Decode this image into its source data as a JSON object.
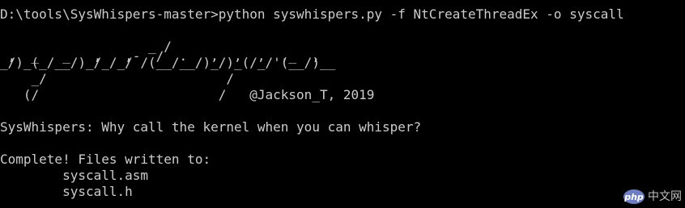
{
  "terminal": {
    "background": "#000000",
    "foreground": "#cccccc",
    "lines": [
      "D:\\tools\\SysWhispers-master>python syswhispers.py -f NtCreateThreadEx -o syscall",
      "",
      "                   _ /",
      " ,  _   _   ,   ,-  /  .   ,  ,  ,  ,_  ,",
      "_/)_(_/__/)_/_/_/ /(__/__/)_/)_(/_/'(__/)__",
      "    _/                       /",
      "   (/                       /   @Jackson_T, 2019",
      "",
      "SysWhispers: Why call the kernel when you can whisper?",
      "",
      "Complete! Files written to:",
      "        syscall.asm",
      "        syscall.h"
    ]
  },
  "watermark": {
    "logo_text": "php",
    "site_text": "中文网"
  }
}
